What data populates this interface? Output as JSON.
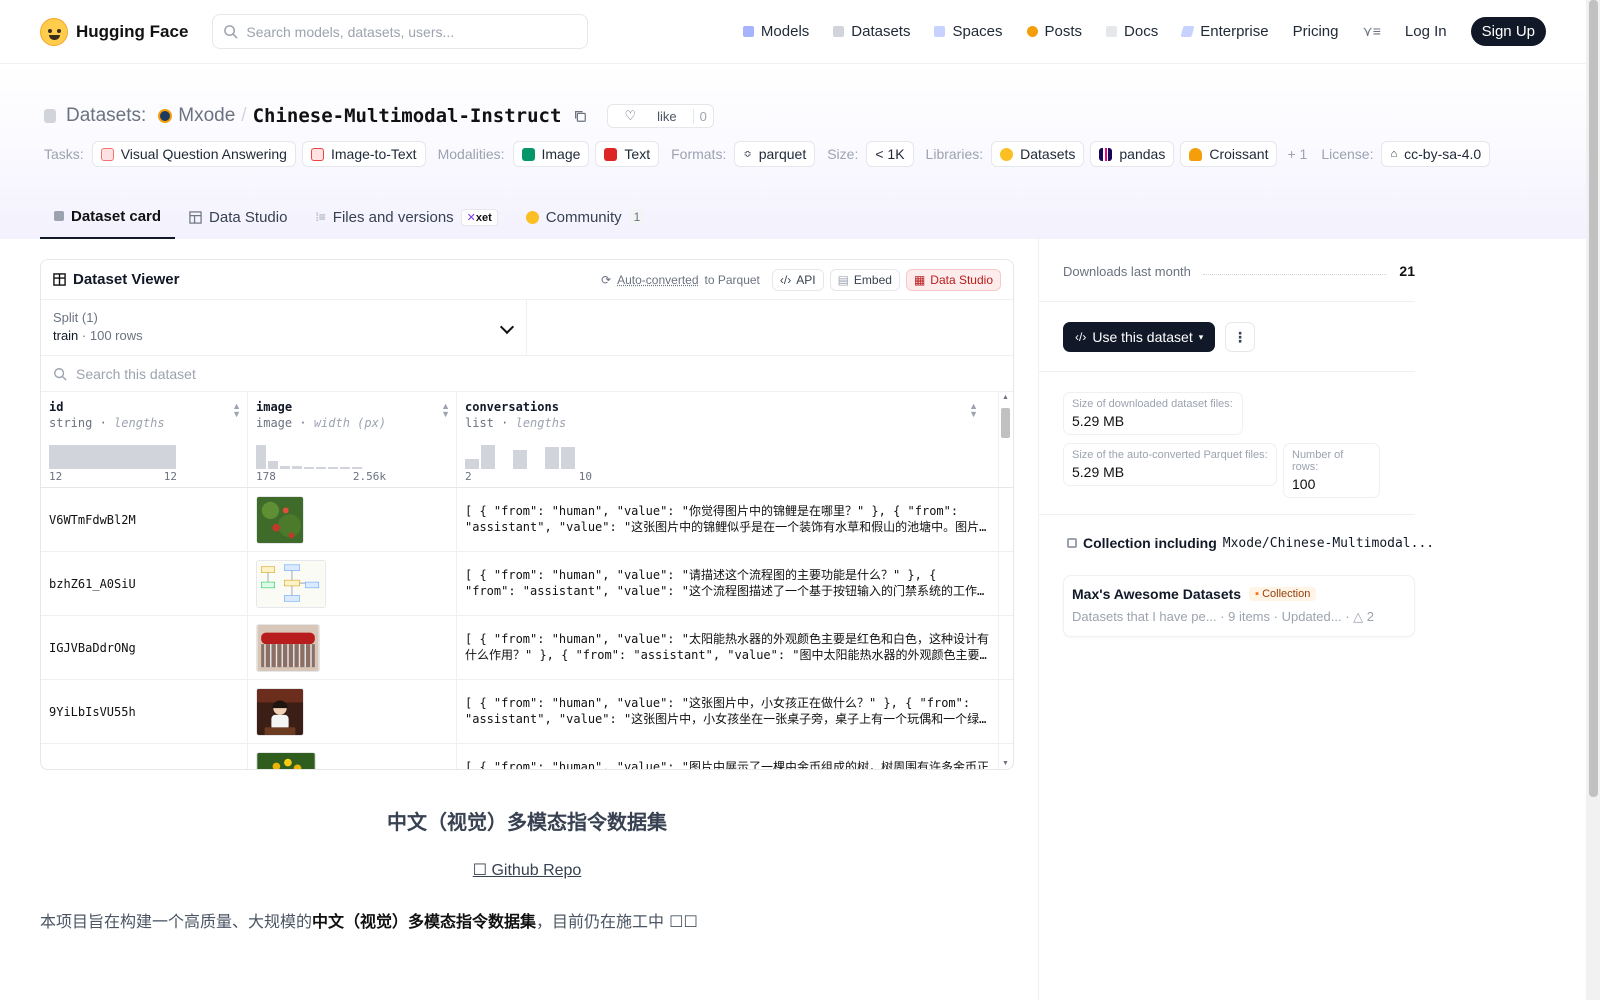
{
  "nav": {
    "brand": "Hugging Face",
    "search_placeholder": "Search models, datasets, users...",
    "links": [
      "Models",
      "Datasets",
      "Spaces",
      "Posts",
      "Docs",
      "Enterprise",
      "Pricing"
    ],
    "login": "Log In",
    "signup": "Sign Up"
  },
  "repo": {
    "section": "Datasets:",
    "owner": "Mxode",
    "name": "Chinese-Multimodal-Instruct",
    "like_label": "like",
    "like_count": "0"
  },
  "tags": {
    "tasks_label": "Tasks:",
    "tasks": [
      "Visual Question Answering",
      "Image-to-Text"
    ],
    "modalities_label": "Modalities:",
    "modalities": [
      "Image",
      "Text"
    ],
    "formats_label": "Formats:",
    "formats": [
      "parquet"
    ],
    "size_label": "Size:",
    "size": "< 1K",
    "libraries_label": "Libraries:",
    "libraries": [
      "Datasets",
      "pandas",
      "Croissant"
    ],
    "libraries_more": "+ 1",
    "license_label": "License:",
    "license": "cc-by-sa-4.0"
  },
  "tabs": {
    "card": "Dataset card",
    "studio": "Data Studio",
    "files": "Files and versions",
    "xet": "xet",
    "community": "Community",
    "community_count": "1"
  },
  "viewer": {
    "title": "Dataset Viewer",
    "auto_converted": "Auto-converted",
    "to_parquet": "to Parquet",
    "api": "API",
    "embed": "Embed",
    "data_studio": "Data Studio",
    "split_label": "Split (1)",
    "split_name": "train",
    "split_rows": "100 rows",
    "search_placeholder": "Search this dataset",
    "columns": [
      {
        "name": "id",
        "type": "string",
        "stat": "lengths",
        "min": "12",
        "max": "12"
      },
      {
        "name": "image",
        "type": "image",
        "stat": "width (px)",
        "min": "178",
        "max": "2.56k"
      },
      {
        "name": "conversations",
        "type": "list",
        "stat": "lengths",
        "min": "2",
        "max": "10"
      }
    ],
    "histograms": {
      "id": [
        1.0
      ],
      "image": [
        1.0,
        0.35,
        0.12,
        0.12,
        0.05,
        0.05,
        0.05,
        0.05,
        0.05
      ],
      "conversations": [
        0.4,
        1.0,
        0.0,
        0.8,
        0.0,
        0.9,
        0.9
      ]
    },
    "rows": [
      {
        "id": "V6WTmFdwBl2M",
        "conv": "[ { \"from\": \"human\", \"value\": \"你觉得图片中的锦鲤是在哪里？\" }, { \"from\": \"assistant\", \"value\": \"这张图片中的锦鲤似乎是在一个装饰有水草和假山的池塘中。图片中…"
      },
      {
        "id": "bzhZ61_A0SiU",
        "conv": "[ { \"from\": \"human\", \"value\": \"请描述这个流程图的主要功能是什么？\" }, { \"from\": \"assistant\", \"value\": \"这个流程图描述了一个基于按钮输入的门禁系统的工作流程。主要功…"
      },
      {
        "id": "IGJVBaDdrONg",
        "conv": "[ { \"from\": \"human\", \"value\": \"太阳能热水器的外观颜色主要是红色和白色，这种设计有什么作用？\" }, { \"from\": \"assistant\", \"value\": \"图中太阳能热水器的外观颜色主要是红色…"
      },
      {
        "id": "9YiLbIsVU55h",
        "conv": "[ { \"from\": \"human\", \"value\": \"这张图片中，小女孩正在做什么？\" }, { \"from\": \"assistant\", \"value\": \"这张图片中，小女孩坐在一张桌子旁，桌子上有一个玩偶和一个绿色…"
      },
      {
        "id": "",
        "conv": "[ { \"from\": \"human\", \"value\": \"图片中展示了一棵由金币组成的树，树周围有许多金币正在"
      }
    ]
  },
  "readme": {
    "title": "中文（视觉）多模态指令数据集",
    "repo_link": "☐ Github Repo",
    "intro_pre": "本项目旨在构建一个高质量、大规模的",
    "intro_bold": "中文（视觉）多模态指令数据集",
    "intro_post": "，目前仍在施工中 ☐☐"
  },
  "sidebar": {
    "downloads_label": "Downloads last month",
    "downloads": "21",
    "use_dataset": "Use this dataset",
    "size_dl_label": "Size of downloaded dataset files:",
    "size_dl": "5.29 MB",
    "size_parquet_label": "Size of the auto-converted Parquet files:",
    "size_parquet": "5.29 MB",
    "rows_label": "Number of rows:",
    "rows": "100",
    "collection_heading": "Collection including",
    "collection_repo": "Mxode/Chinese-Multimodal...",
    "collection_title": "Max's Awesome Datasets",
    "collection_badge": "Collection",
    "collection_desc": "Datasets that I have pe...",
    "collection_items": "9 items",
    "collection_updated": "Updated...",
    "collection_upvotes": "2"
  }
}
